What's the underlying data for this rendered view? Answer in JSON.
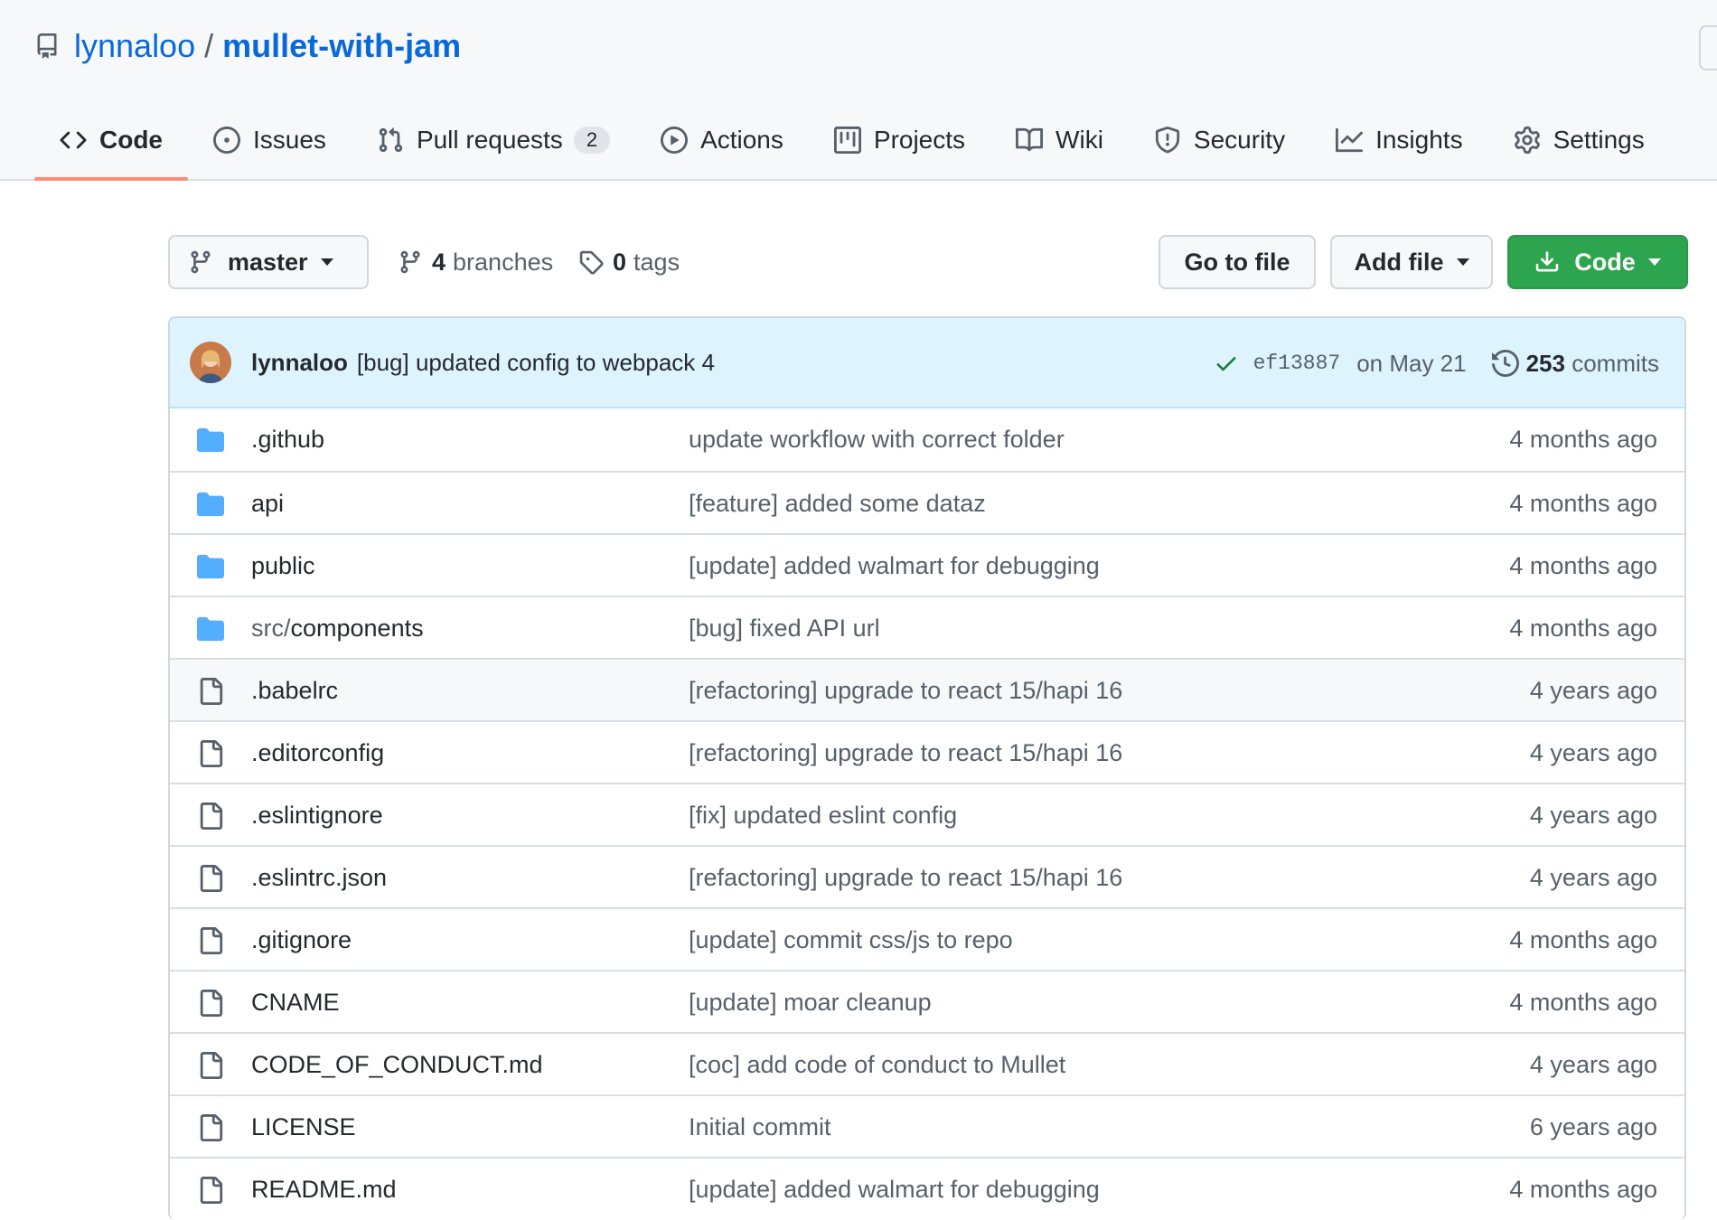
{
  "repo": {
    "owner": "lynnaloo",
    "separator": "/",
    "name": "mullet-with-jam"
  },
  "tabs": [
    {
      "label": "Code",
      "icon": "code-icon",
      "active": true
    },
    {
      "label": "Issues",
      "icon": "issue-icon"
    },
    {
      "label": "Pull requests",
      "icon": "pull-request-icon",
      "count": "2"
    },
    {
      "label": "Actions",
      "icon": "play-icon"
    },
    {
      "label": "Projects",
      "icon": "project-icon"
    },
    {
      "label": "Wiki",
      "icon": "book-icon"
    },
    {
      "label": "Security",
      "icon": "shield-icon"
    },
    {
      "label": "Insights",
      "icon": "graph-icon"
    },
    {
      "label": "Settings",
      "icon": "gear-icon"
    }
  ],
  "toolbar": {
    "branch": "master",
    "branches_count": "4",
    "branches_label": "branches",
    "tags_count": "0",
    "tags_label": "tags",
    "go_to_file": "Go to file",
    "add_file": "Add file",
    "code": "Code"
  },
  "latest_commit": {
    "author": "lynnaloo",
    "message": "[bug] updated config to webpack 4",
    "sha": "ef13887",
    "date": "on May 21",
    "commits_count": "253",
    "commits_label": "commits"
  },
  "files": [
    {
      "type": "dir",
      "prefix": "",
      "name": ".github",
      "message": "update workflow with correct folder",
      "age": "4 months ago"
    },
    {
      "type": "dir",
      "prefix": "",
      "name": "api",
      "message": "[feature] added some dataz",
      "age": "4 months ago"
    },
    {
      "type": "dir",
      "prefix": "",
      "name": "public",
      "message": "[update] added walmart for debugging",
      "age": "4 months ago"
    },
    {
      "type": "dir",
      "prefix": "src/",
      "name": "components",
      "message": "[bug] fixed API url",
      "age": "4 months ago"
    },
    {
      "type": "file",
      "prefix": "",
      "name": ".babelrc",
      "message": "[refactoring] upgrade to react 15/hapi 16",
      "age": "4 years ago"
    },
    {
      "type": "file",
      "prefix": "",
      "name": ".editorconfig",
      "message": "[refactoring] upgrade to react 15/hapi 16",
      "age": "4 years ago"
    },
    {
      "type": "file",
      "prefix": "",
      "name": ".eslintignore",
      "message": "[fix] updated eslint config",
      "age": "4 years ago"
    },
    {
      "type": "file",
      "prefix": "",
      "name": ".eslintrc.json",
      "message": "[refactoring] upgrade to react 15/hapi 16",
      "age": "4 years ago"
    },
    {
      "type": "file",
      "prefix": "",
      "name": ".gitignore",
      "message": "[update] commit css/js to repo",
      "age": "4 months ago"
    },
    {
      "type": "file",
      "prefix": "",
      "name": "CNAME",
      "message": "[update] moar cleanup",
      "age": "4 months ago"
    },
    {
      "type": "file",
      "prefix": "",
      "name": "CODE_OF_CONDUCT.md",
      "message": "[coc] add code of conduct to Mullet",
      "age": "4 years ago"
    },
    {
      "type": "file",
      "prefix": "",
      "name": "LICENSE",
      "message": "Initial commit",
      "age": "6 years ago"
    },
    {
      "type": "file",
      "prefix": "",
      "name": "README.md",
      "message": "[update] added walmart for debugging",
      "age": "4 months ago"
    }
  ],
  "colors": {
    "link": "#0969da",
    "folder": "#54aeff",
    "primary_button": "#2da44e",
    "active_tab_underline": "#fd8c73",
    "commit_header_bg": "#ddf4ff"
  }
}
